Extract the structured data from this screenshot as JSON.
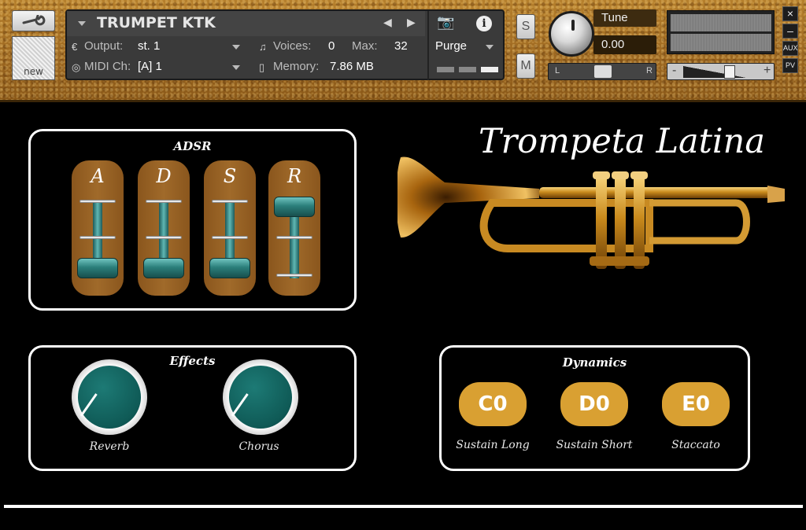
{
  "header": {
    "new_label": "new",
    "instrument_name": "TRUMPET KTK",
    "output_label": "Output:",
    "output_value": "st. 1",
    "voices_label": "Voices:",
    "voices_value": "0",
    "max_label": "Max:",
    "max_value": "32",
    "purge_label": "Purge",
    "midi_label": "MIDI Ch:",
    "midi_value": "[A]  1",
    "memory_label": "Memory:",
    "memory_value": "7.86 MB",
    "solo_label": "S",
    "mute_label": "M",
    "tune_label": "Tune",
    "tune_value": "0.00",
    "pan_left": "L",
    "pan_right": "R",
    "vol_minus": "-",
    "vol_plus": "+",
    "close_label": "×",
    "minimize_label": "–",
    "aux_label": "AUX",
    "pv_label": "PV"
  },
  "adsr": {
    "title": "ADSR",
    "sliders": [
      {
        "letter": "A",
        "level": 0.0
      },
      {
        "letter": "D",
        "level": 0.0
      },
      {
        "letter": "S",
        "level": 0.0
      },
      {
        "letter": "R",
        "level": 1.0
      }
    ]
  },
  "title": "Trompeta Latina",
  "effects": {
    "title": "Effects",
    "knobs": [
      {
        "label": "Reverb"
      },
      {
        "label": "Chorus"
      }
    ]
  },
  "dynamics": {
    "title": "Dynamics",
    "buttons": [
      {
        "key": "C0",
        "label": "Sustain Long"
      },
      {
        "key": "D0",
        "label": "Sustain Short"
      },
      {
        "key": "E0",
        "label": "Staccato"
      }
    ]
  },
  "colors": {
    "accent_gold": "#d9a032",
    "slider_brown": "#a06a2a",
    "knob_teal": "#1d7a75"
  }
}
